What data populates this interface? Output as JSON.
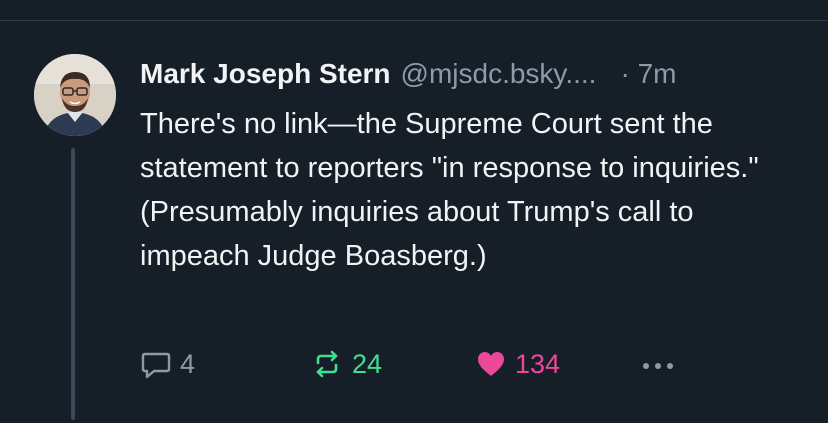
{
  "post": {
    "author_name": "Mark Joseph Stern",
    "handle": "@mjsdc.bsky....",
    "timestamp": "· 7m",
    "text": "There's no link—the Supreme Court sent the statement to reporters \"in response to inquiries.\" (Presumably inquiries about Trump's call to impeach Judge Boasberg.)"
  },
  "actions": {
    "reply_count": "4",
    "repost_count": "24",
    "like_count": "134",
    "reply_icon": "speech-bubble-icon",
    "repost_icon": "repost-arrows-icon",
    "like_icon": "heart-icon",
    "more_icon": "ellipsis-icon"
  },
  "colors": {
    "background": "#161e27",
    "text": "#f1f3f5",
    "muted": "#8c9baa",
    "repost": "#3ee08f",
    "like": "#ec4899"
  }
}
